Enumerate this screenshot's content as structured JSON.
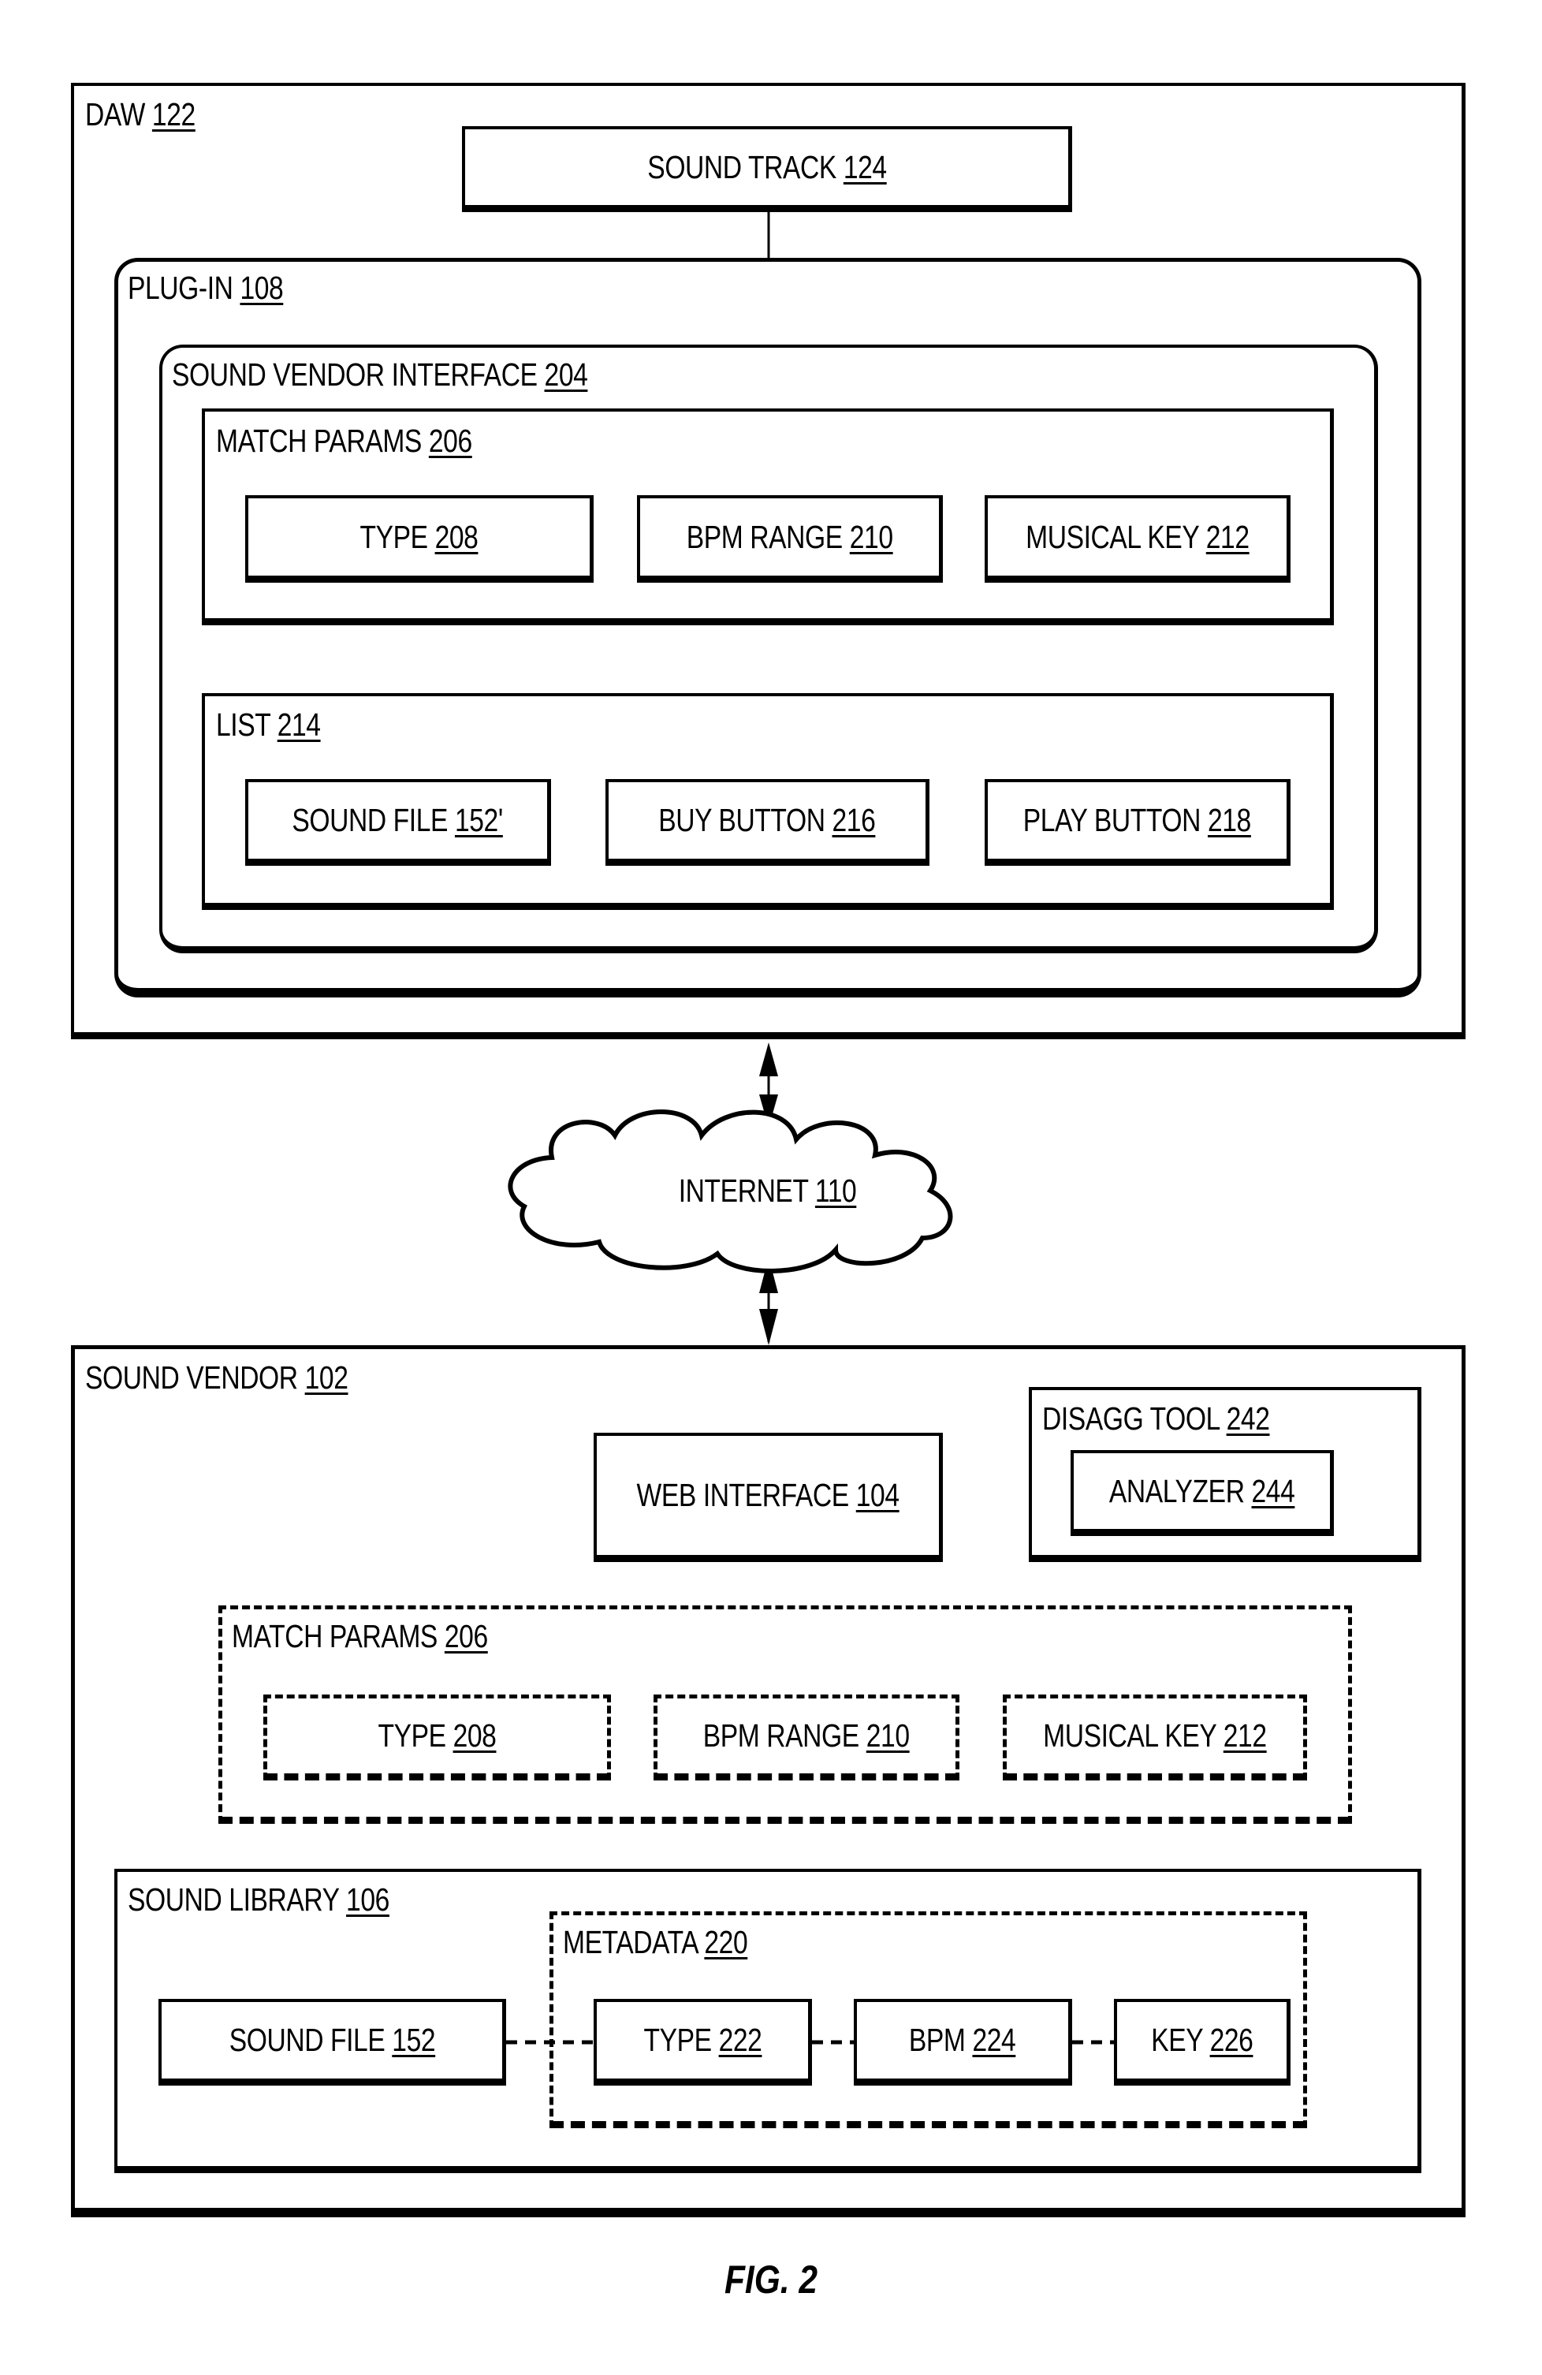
{
  "figure_label": "FIG. 2",
  "daw": {
    "name": "DAW",
    "ref": "122",
    "sound_track": {
      "name": "SOUND TRACK",
      "ref": "124"
    },
    "plugin": {
      "name": "PLUG-IN",
      "ref": "108",
      "sound_vendor_interface": {
        "name": "SOUND VENDOR INTERFACE",
        "ref": "204",
        "match_params": {
          "name": "MATCH PARAMS",
          "ref": "206",
          "items": [
            {
              "name": "TYPE",
              "ref": "208"
            },
            {
              "name": "BPM RANGE",
              "ref": "210"
            },
            {
              "name": "MUSICAL KEY",
              "ref": "212"
            }
          ]
        },
        "list": {
          "name": "LIST",
          "ref": "214",
          "items": [
            {
              "name": "SOUND FILE",
              "ref": "152'"
            },
            {
              "name": "BUY BUTTON",
              "ref": "216"
            },
            {
              "name": "PLAY BUTTON",
              "ref": "218"
            }
          ]
        }
      }
    }
  },
  "internet": {
    "name": "INTERNET",
    "ref": "110"
  },
  "sound_vendor": {
    "name": "SOUND VENDOR",
    "ref": "102",
    "web_interface": {
      "name": "WEB INTERFACE",
      "ref": "104"
    },
    "disagg_tool": {
      "name": "DISAGG TOOL",
      "ref": "242",
      "analyzer": {
        "name": "ANALYZER",
        "ref": "244"
      }
    },
    "match_params": {
      "name": "MATCH PARAMS",
      "ref": "206",
      "items": [
        {
          "name": "TYPE",
          "ref": "208"
        },
        {
          "name": "BPM RANGE",
          "ref": "210"
        },
        {
          "name": "MUSICAL KEY",
          "ref": "212"
        }
      ]
    },
    "sound_library": {
      "name": "SOUND LIBRARY",
      "ref": "106",
      "sound_file": {
        "name": "SOUND FILE",
        "ref": "152"
      },
      "metadata": {
        "name": "METADATA",
        "ref": "220",
        "items": [
          {
            "name": "TYPE",
            "ref": "222"
          },
          {
            "name": "BPM",
            "ref": "224"
          },
          {
            "name": "KEY",
            "ref": "226"
          }
        ]
      }
    }
  }
}
